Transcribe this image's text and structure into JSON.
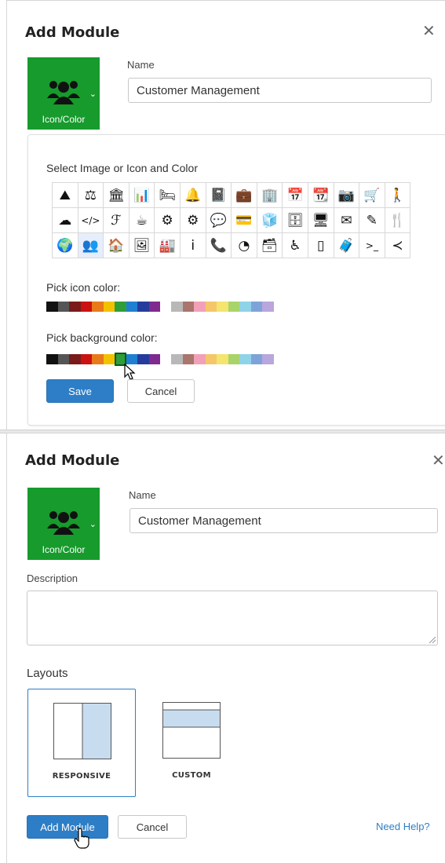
{
  "colors": {
    "tile_bg": "#169b2c",
    "primary": "#2d7ec6",
    "link": "#2d7ec6"
  },
  "panel1": {
    "title": "Add Module",
    "close_icon": "close-icon",
    "tile": {
      "icon": "users-icon",
      "label": "Icon/Color"
    },
    "name_label": "Name",
    "name_value": "Customer Management",
    "picker": {
      "heading": "Select Image or Icon and Color",
      "icons": [
        [
          "⛰",
          "⚖",
          "🏛",
          "📊",
          "🛏",
          "🔔",
          "📓",
          "💼",
          "🏢",
          "📅",
          "📆",
          "📷",
          "🛒",
          "🚶"
        ],
        [
          "☁",
          "</>",
          "ℱ",
          "☕",
          "⚙",
          "⚙",
          "💬",
          "💳",
          "🧊",
          "🗄",
          "🖥",
          "✉",
          "✎",
          "🍴"
        ],
        [
          "🌍",
          "👥",
          "🏠",
          "🖼",
          "🏭",
          "i",
          "📞",
          "◔",
          "🗃",
          "♿",
          "▯",
          "🧳",
          ">_",
          "≺"
        ]
      ],
      "icon_color_label": "Pick icon color:",
      "bg_color_label": "Pick background color:",
      "swatches_dark": [
        "#111111",
        "#555555",
        "#7a1a1a",
        "#cc1111",
        "#e87a1a",
        "#f2c200",
        "#2f9e3a",
        "#1f7fd1",
        "#263c9c",
        "#7f2a8f"
      ],
      "swatches_light": [
        "#b8b8b8",
        "#a9756d",
        "#f2a0b8",
        "#f5c76a",
        "#f3e56e",
        "#a8d46a",
        "#8fd3e8",
        "#7ea3d9",
        "#b9a6dc"
      ],
      "selected_bg_index": 6,
      "save_label": "Save",
      "cancel_label": "Cancel"
    }
  },
  "panel2": {
    "title": "Add Module",
    "close_icon": "close-icon",
    "tile": {
      "icon": "users-icon",
      "label": "Icon/Color"
    },
    "name_label": "Name",
    "name_value": "Customer Management",
    "description_label": "Description",
    "description_value": "",
    "layouts_label": "Layouts",
    "layouts": [
      {
        "label": "RESPONSIVE",
        "selected": true
      },
      {
        "label": "CUSTOM",
        "selected": false
      }
    ],
    "add_label": "Add Module",
    "cancel_label": "Cancel",
    "help_label": "Need Help?"
  }
}
